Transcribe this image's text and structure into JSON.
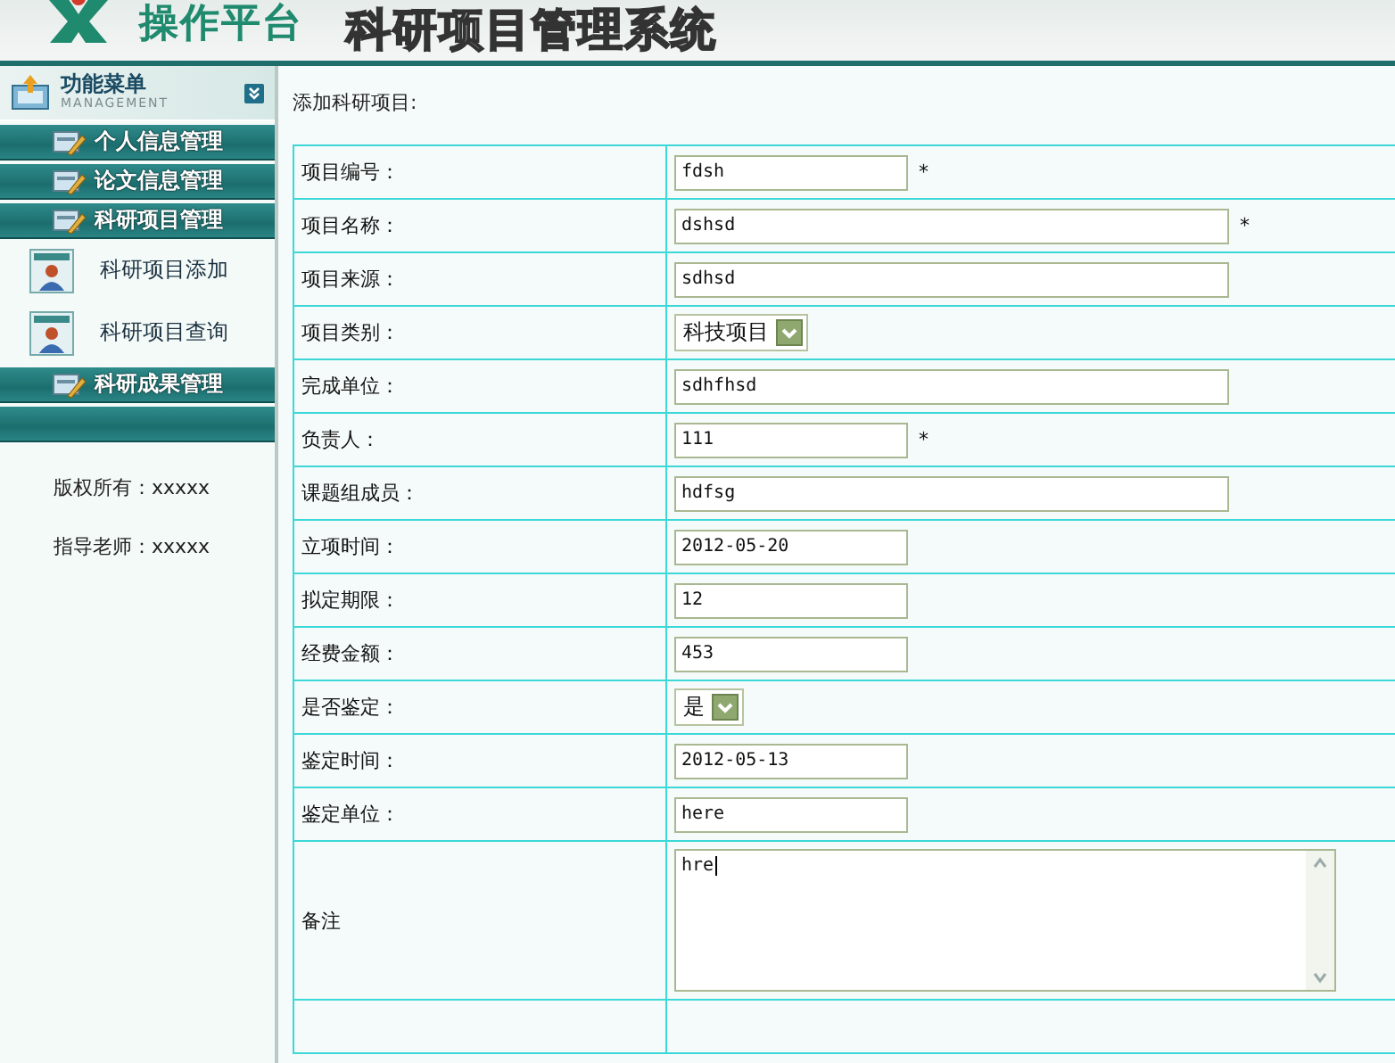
{
  "header": {
    "logo_text": "操作平台",
    "title": "科研项目管理系统"
  },
  "sidebar": {
    "menu_title": "功能菜单",
    "menu_subtitle": "MANAGEMENT",
    "sections": [
      {
        "label": "个人信息管理"
      },
      {
        "label": "论文信息管理"
      },
      {
        "label": "科研项目管理",
        "items": [
          "科研项目添加",
          "科研项目查询"
        ]
      },
      {
        "label": "科研成果管理"
      }
    ],
    "footer": [
      "版权所有：xxxxx",
      "指导老师：xxxxx"
    ]
  },
  "form": {
    "title": "添加科研项目:",
    "rows": [
      {
        "label": "项目编号：",
        "kind": "text",
        "wide": false,
        "value": "fdsh",
        "mark": "*"
      },
      {
        "label": "项目名称：",
        "kind": "text",
        "wide": true,
        "value": "dshsd",
        "mark": "*"
      },
      {
        "label": "项目来源：",
        "kind": "text",
        "wide": true,
        "value": "sdhsd"
      },
      {
        "label": "项目类别：",
        "kind": "select",
        "value": "科技项目"
      },
      {
        "label": "完成单位：",
        "kind": "text",
        "wide": true,
        "value": "sdhfhsd"
      },
      {
        "label": "负责人：",
        "kind": "text",
        "wide": false,
        "value": "111",
        "mark": "*"
      },
      {
        "label": "课题组成员：",
        "kind": "text",
        "wide": true,
        "value": "hdfsg"
      },
      {
        "label": "立项时间：",
        "kind": "text",
        "wide": false,
        "value": "2012-05-20"
      },
      {
        "label": "拟定期限：",
        "kind": "text",
        "wide": false,
        "value": "12"
      },
      {
        "label": "经费金额：",
        "kind": "text",
        "wide": false,
        "value": "453"
      },
      {
        "label": "是否鉴定：",
        "kind": "select",
        "value": "是"
      },
      {
        "label": "鉴定时间：",
        "kind": "text",
        "wide": false,
        "value": "2012-05-13"
      },
      {
        "label": "鉴定单位：",
        "kind": "text",
        "wide": false,
        "value": "here"
      },
      {
        "label": "备注",
        "kind": "textarea",
        "value": "hre"
      },
      {
        "kind": "empty"
      }
    ]
  }
}
